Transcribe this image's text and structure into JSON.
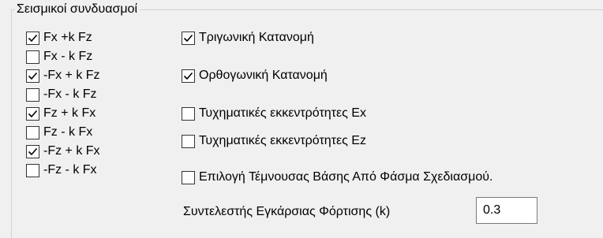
{
  "group": {
    "title": "Σεισμικοί συνδυασμοί"
  },
  "left_checks": [
    {
      "label": "Fx +k Fz",
      "checked": true
    },
    {
      "label": "Fx - k Fz",
      "checked": false
    },
    {
      "label": "-Fx + k Fz",
      "checked": true
    },
    {
      "label": "-Fx - k Fz",
      "checked": false
    },
    {
      "label": "Fz + k Fx",
      "checked": true
    },
    {
      "label": "Fz - k Fx",
      "checked": false
    },
    {
      "label": "-Fz + k Fx",
      "checked": true
    },
    {
      "label": "-Fz - k Fx",
      "checked": false
    }
  ],
  "right_checks": [
    {
      "label": "Τριγωνική Κατανομή",
      "checked": true
    },
    {
      "label": "Ορθογωνική Κατανομή",
      "checked": true
    },
    {
      "label": "Τυχηματικές εκκεντρότητες Ex",
      "checked": false
    },
    {
      "label": "Τυχηματικές εκκεντρότητες Ez",
      "checked": false
    },
    {
      "label": "Επιλογή Τέμνουσας Βάσης Από Φάσμα Σχεδιασμού.",
      "checked": false
    }
  ],
  "coefficient": {
    "label": "Συντελεστής Εγκάρσιας Φόρτισης (k)",
    "value": "0.3"
  }
}
